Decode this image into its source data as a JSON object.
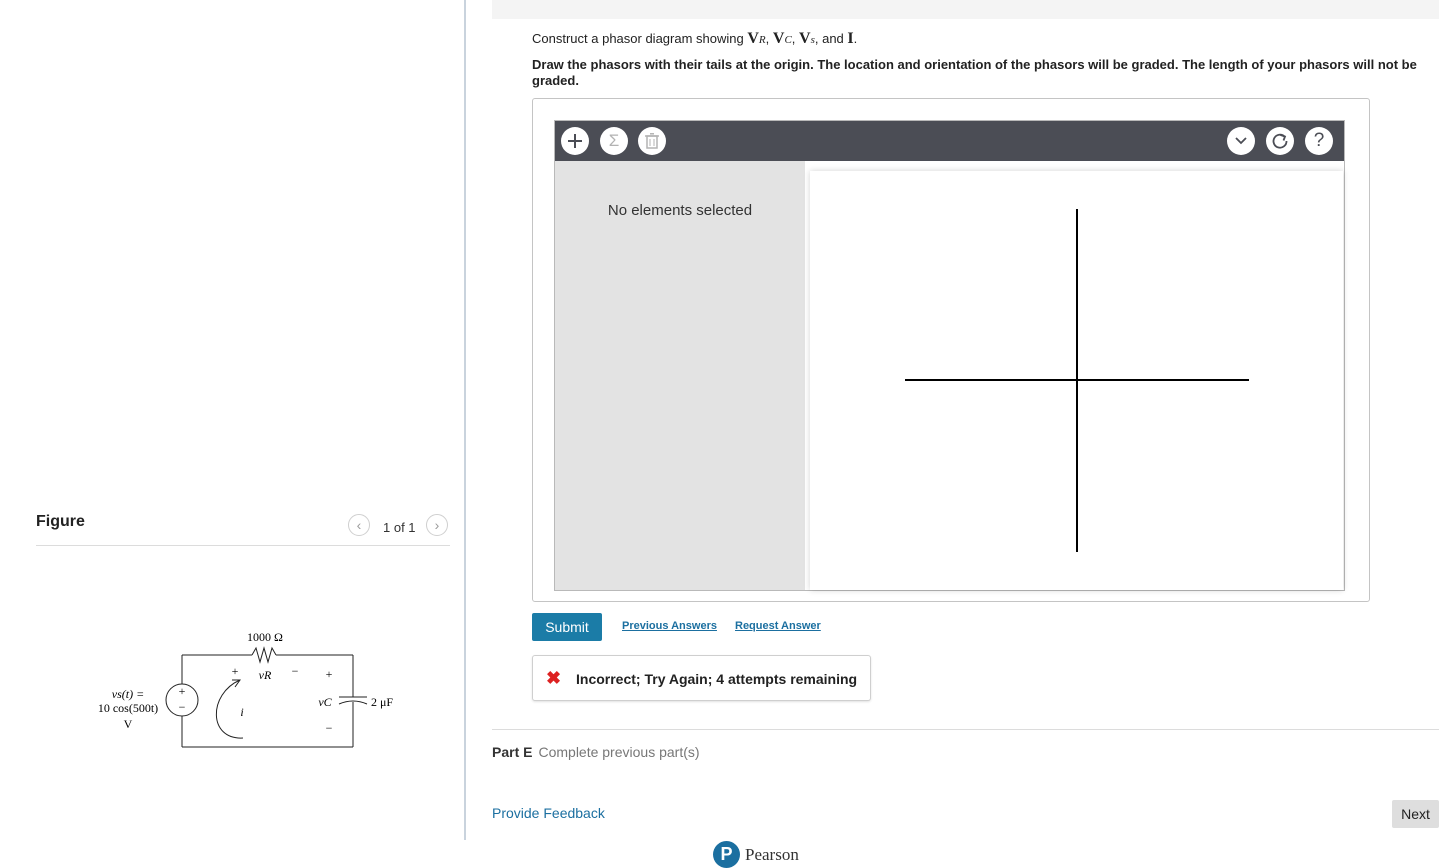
{
  "figure": {
    "title": "Figure",
    "pager_text": "1 of 1",
    "circuit": {
      "resistor_label": "1000 Ω",
      "source_label_line1": "vs(t) =",
      "source_label_line2": "10 cos(500t)",
      "source_label_line3": "V",
      "vr_label": "vR",
      "vc_label": "vC",
      "current_label": "i",
      "capacitor_label": "2 μF",
      "plus": "+",
      "minus": "−"
    }
  },
  "question": {
    "prompt_prefix": "Construct a phasor diagram showing ",
    "sym_v": "V",
    "sub_r": "R",
    "sub_c": "C",
    "sub_s": "s",
    "sym_i": "I",
    "sep_comma": ", ",
    "and_text": ", and ",
    "period": ".",
    "instruction": "Draw the phasors with their tails at the origin. The location and orientation of the phasors will be graded. The length of your phasors will not be graded."
  },
  "tool": {
    "no_selection": "No elements selected",
    "help_label": "?",
    "icons": [
      "plus-icon",
      "sigma-icon",
      "trash-icon",
      "chevron-down-icon",
      "reset-icon",
      "help-icon"
    ]
  },
  "actions": {
    "submit_label": "Submit",
    "previous_answers": "Previous Answers",
    "request_answer": "Request Answer"
  },
  "feedback": {
    "status_icon": "✖",
    "message": "Incorrect; Try Again; 4 attempts remaining",
    "color": "#dd2222"
  },
  "part_e": {
    "label": "Part E",
    "status": "Complete previous part(s)"
  },
  "footer": {
    "provide_feedback": "Provide Feedback",
    "next_label": "Next",
    "brand": "Pearson",
    "brand_color": "#1b6fa0"
  }
}
